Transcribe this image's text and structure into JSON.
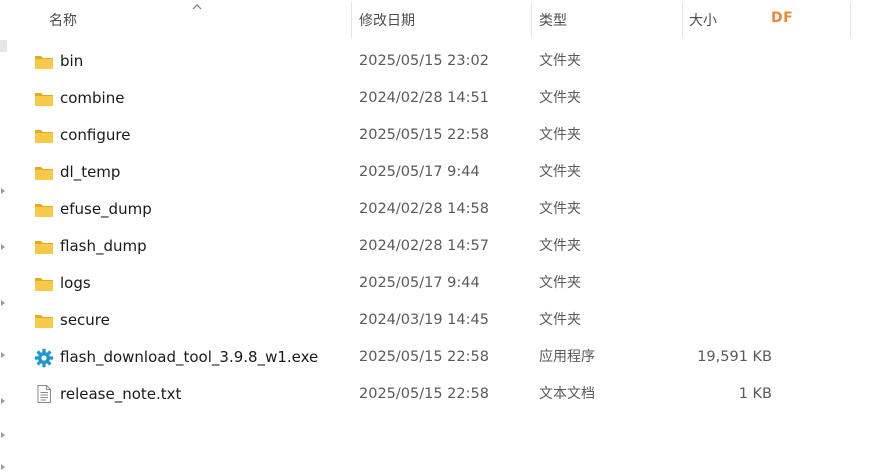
{
  "header": {
    "name": "名称",
    "date": "修改日期",
    "type": "类型",
    "size": "大小",
    "badge": "DF"
  },
  "colors": {
    "folder": "#f7c948",
    "folder_dark": "#e8a91e",
    "badge": "#f0863a",
    "exe_gear": "#1e96d6"
  },
  "files": [
    {
      "name": "bin",
      "date": "2025/05/15 23:02",
      "type": "文件夹",
      "size": "",
      "icon": "folder-icon"
    },
    {
      "name": "combine",
      "date": "2024/02/28 14:51",
      "type": "文件夹",
      "size": "",
      "icon": "folder-icon"
    },
    {
      "name": "configure",
      "date": "2025/05/15 22:58",
      "type": "文件夹",
      "size": "",
      "icon": "folder-icon"
    },
    {
      "name": "dl_temp",
      "date": "2025/05/17 9:44",
      "type": "文件夹",
      "size": "",
      "icon": "folder-icon"
    },
    {
      "name": "efuse_dump",
      "date": "2024/02/28 14:58",
      "type": "文件夹",
      "size": "",
      "icon": "folder-icon"
    },
    {
      "name": "flash_dump",
      "date": "2024/02/28 14:57",
      "type": "文件夹",
      "size": "",
      "icon": "folder-icon"
    },
    {
      "name": "logs",
      "date": "2025/05/17 9:44",
      "type": "文件夹",
      "size": "",
      "icon": "folder-icon"
    },
    {
      "name": "secure",
      "date": "2024/03/19 14:45",
      "type": "文件夹",
      "size": "",
      "icon": "folder-icon"
    },
    {
      "name": "flash_download_tool_3.9.8_w1.exe",
      "date": "2025/05/15 22:58",
      "type": "应用程序",
      "size": "19,591 KB",
      "icon": "gear-icon"
    },
    {
      "name": "release_note.txt",
      "date": "2025/05/15 22:58",
      "type": "文本文档",
      "size": "1 KB",
      "icon": "text-file-icon"
    }
  ]
}
